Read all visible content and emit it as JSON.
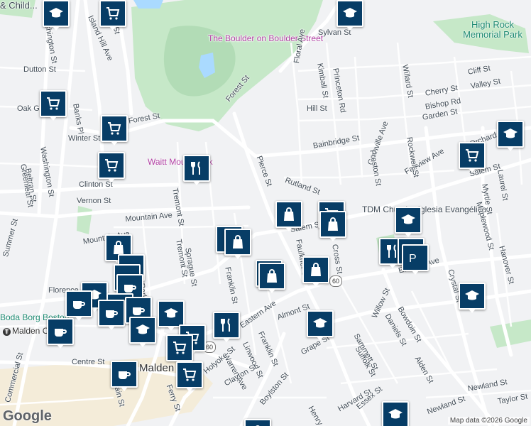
{
  "streets": [
    "Main St",
    "Island Hill Ave",
    "Washington St",
    "Dutton St",
    "Oak G",
    "Banks Pl",
    "Winter St",
    "Forest St",
    "Forest St",
    "Sylvan St",
    "Floral Ave",
    "Kimball St",
    "Princeton Rd",
    "Hill St",
    "Cherry St",
    "Valley St",
    "Cliff St",
    "Bishop Rd",
    "Garden St",
    "Willard St",
    "Bainbridge St",
    "Pierce St",
    "Rutland St",
    "Granville Ave",
    "Preston St",
    "Fairview Ave",
    "Orchard",
    "Rockwell St",
    "Salem St",
    "Salem St",
    "Myrtle St",
    "Laurel St",
    "Maplewood St",
    "Clinton St",
    "Vernon St",
    "Beltran St",
    "Greenleaf St",
    "Washington St",
    "Summer St",
    "Tremont St",
    "Tremont St",
    "Sprague St",
    "Mountain Ave",
    "Florence",
    "Park St",
    "Franklin St",
    "Franklin St",
    "Linwood St",
    "Eastern Ave",
    "Eastern Ave",
    "Almont St",
    "Bowdoin St",
    "Daniels St",
    "Willow St",
    "Crystal St",
    "Hanover St",
    "Cross St",
    "Faulkner St",
    "Grape St",
    "Sammett St",
    "Suffolk St",
    "Alden St",
    "Newland St",
    "Newland St",
    "Taylor St",
    "Warren Ave",
    "Holyoke St",
    "Clayton St",
    "Ferry St",
    "Centre St",
    "Commercial St",
    "Henry St",
    "Harvard St",
    "Essex St",
    "Malden Center",
    "Main St",
    "Boylston St",
    "Mountain Ave"
  ],
  "places": {
    "boulder": "The Boulder on Boulder Street",
    "park_waitt": "Waitt Mount Park",
    "high_rock": "High Rock Memorial Park",
    "church": "TDM Church - Iglesia Evangélica",
    "boda_borg": "Boda Borg Boston",
    "malden": "Malden",
    "malden_center": "Malden Center",
    "childs": "& Child..."
  },
  "route_shield": "60",
  "footer": {
    "logo": "Google",
    "attribution": "Map data ©2026 Google"
  },
  "colors": {
    "pin": "#073d66",
    "park": "#c6e8c8",
    "water": "#aadaff",
    "poi": "#b13fa3",
    "park_label": "#1e8a72"
  },
  "pins": [
    {
      "icon": "shopping-bag-icon"
    },
    {
      "icon": "shopping-cart-icon"
    },
    {
      "icon": "coffee-cup-icon"
    },
    {
      "icon": "utensils-icon"
    },
    {
      "icon": "graduation-cap-icon"
    },
    {
      "icon": "pharmacy-icon"
    }
  ]
}
